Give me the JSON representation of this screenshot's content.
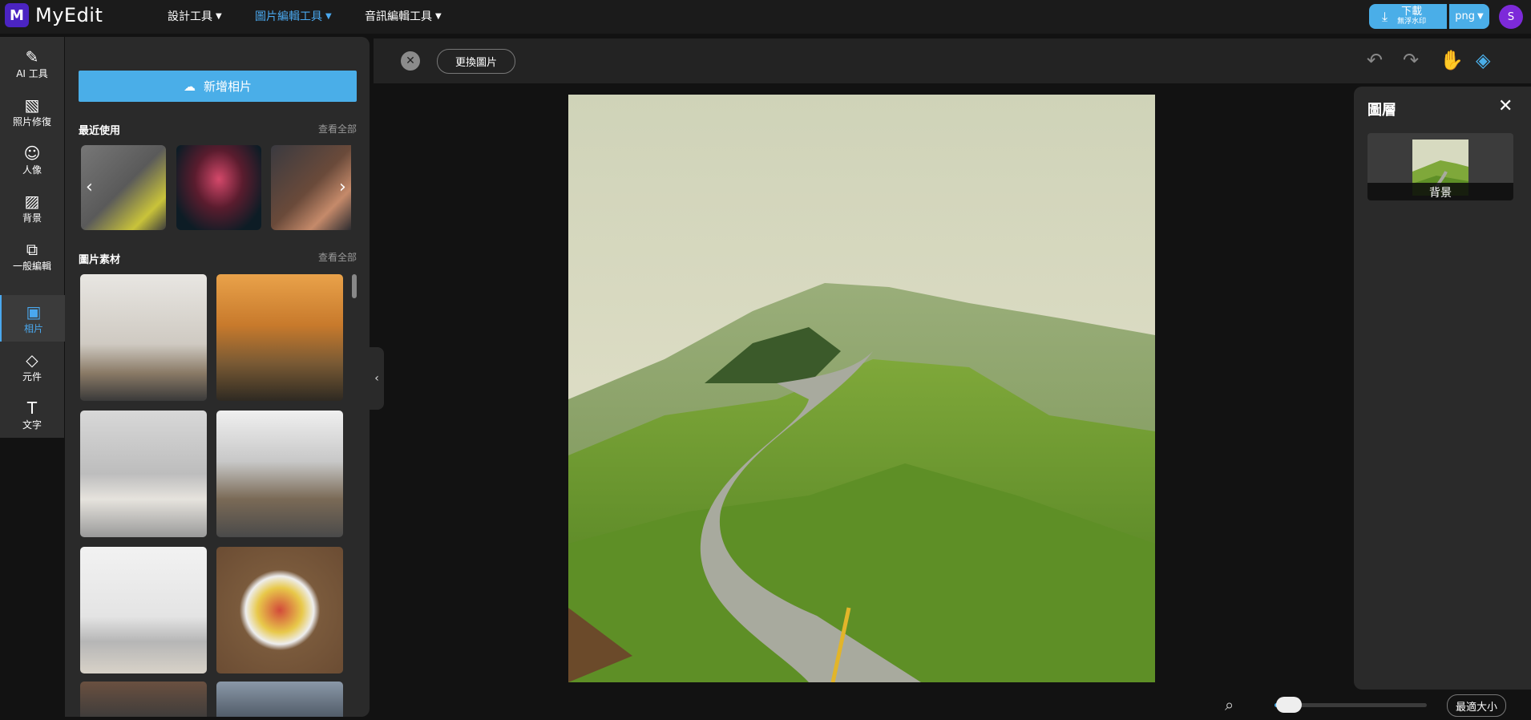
{
  "app": {
    "name": "MyEdit"
  },
  "top_nav": [
    {
      "label": "設計工具"
    },
    {
      "label": "圖片編輯工具"
    },
    {
      "label": "音訊編輯工具"
    }
  ],
  "download": {
    "label": "下載",
    "sublabel": "無浮水印",
    "format": "png"
  },
  "user": {
    "initial": "S"
  },
  "icon_rail": [
    {
      "label": "AI 工具",
      "icon": "magic-wand-icon"
    },
    {
      "label": "照片修復",
      "icon": "photo-repair-icon"
    },
    {
      "label": "人像",
      "icon": "portrait-icon"
    },
    {
      "label": "背景",
      "icon": "background-icon"
    },
    {
      "label": "一般編輯",
      "icon": "general-edit-icon"
    },
    {
      "label": "相片",
      "icon": "photo-icon"
    },
    {
      "label": "元件",
      "icon": "components-icon"
    },
    {
      "label": "文字",
      "icon": "text-icon"
    }
  ],
  "panel": {
    "add_photo": "新增相片",
    "recent_title": "最近使用",
    "recent_view_all": "查看全部",
    "stock_title": "圖片素材",
    "stock_view_all": "查看全部"
  },
  "canvas_toolbar": {
    "replace": "更換圖片"
  },
  "layers": {
    "title": "圖層",
    "items": [
      {
        "label": "背景"
      }
    ]
  },
  "zoom": {
    "fit": "最適大小",
    "level": 0.1
  },
  "colors": {
    "accent": "#4aaee8",
    "brand": "#4b24c2",
    "avatar": "#7d2ad9"
  }
}
